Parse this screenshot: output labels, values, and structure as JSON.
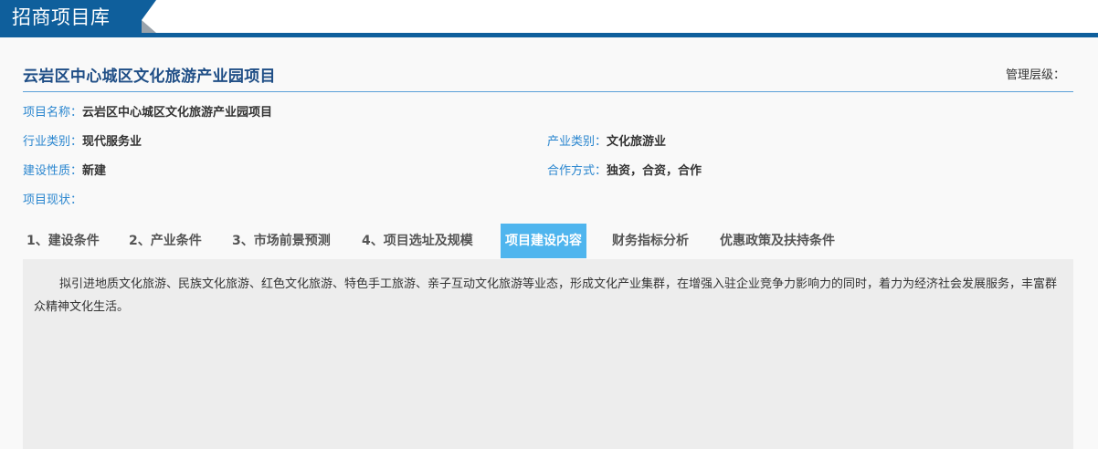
{
  "header": {
    "title": "招商项目库"
  },
  "project": {
    "title": "云岩区中心城区文化旅游产业园项目",
    "management_level_label": "管理层级：",
    "fields": [
      {
        "label": "项目名称：",
        "value": "云岩区中心城区文化旅游产业园项目"
      },
      {
        "label": "行业类别：",
        "value": "现代服务业"
      },
      {
        "label": "产业类别：",
        "value": "文化旅游业"
      },
      {
        "label": "建设性质：",
        "value": "新建"
      },
      {
        "label": "合作方式：",
        "value": "独资，合资，合作"
      },
      {
        "label": "项目现状：",
        "value": ""
      }
    ]
  },
  "tabs": [
    {
      "label": "1、建设条件"
    },
    {
      "label": "2、产业条件"
    },
    {
      "label": "3、市场前景预测"
    },
    {
      "label": "4、项目选址及规模"
    },
    {
      "label": "项目建设内容"
    },
    {
      "label": "财务指标分析"
    },
    {
      "label": "优惠政策及扶持条件"
    }
  ],
  "active_tab": 4,
  "content": {
    "text": "拟引进地质文化旅游、民族文化旅游、红色文化旅游、特色手工旅游、亲子互动文化旅游等业态，形成文化产业集群，在增强入驻企业竞争力影响力的同时，着力为经济社会发展服务，丰富群众精神文化生活。"
  },
  "colors": {
    "brand_blue": "#0f5f9c",
    "title_blue": "#1f4e86",
    "label_blue": "#2a86cf",
    "active_tab": "#4fb5ee"
  }
}
